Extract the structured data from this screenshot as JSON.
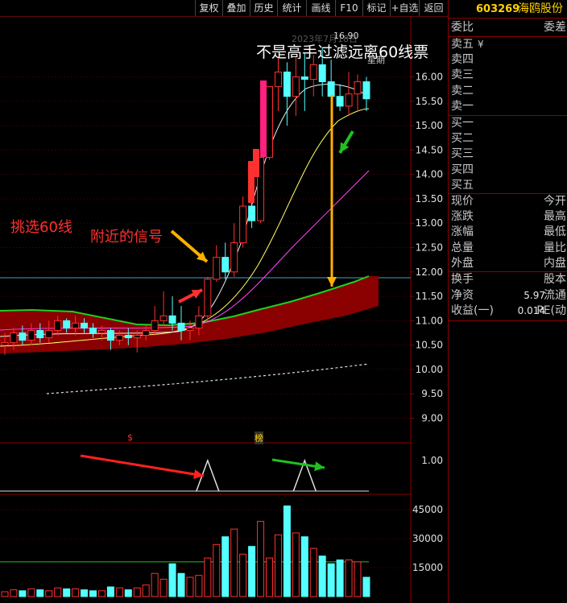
{
  "toolbar": {
    "buttons": [
      "复权",
      "叠加",
      "历史",
      "统计",
      "画线",
      "F10",
      "标记",
      "+自选",
      "返回"
    ]
  },
  "stock": {
    "code": "603269",
    "name": "海鸥股份",
    "code_color": "#ffd200"
  },
  "chart": {
    "date_overlay": "2023年7月18日",
    "date_partial": "星期",
    "high_marker": "16.90",
    "marks": [
      "$",
      "榜"
    ]
  },
  "annotations": {
    "title": "不是高手过滤远离60线票",
    "left_label": "挑选60线",
    "right_label": "附近的信号"
  },
  "quote": {
    "header_left": "委比",
    "header_right": "委差",
    "sell": [
      "卖五",
      "卖四",
      "卖三",
      "卖二",
      "卖一"
    ],
    "sell_suffix": "¥",
    "buy": [
      "买一",
      "买二",
      "买三",
      "买四",
      "买五"
    ],
    "stats_left": [
      "现价",
      "涨跌",
      "涨幅",
      "总量",
      "外盘"
    ],
    "stats_right": [
      "今开",
      "最高",
      "最低",
      "量比",
      "内盘"
    ],
    "fin": [
      {
        "label": "换手",
        "value": "",
        "right": "股本"
      },
      {
        "label": "净资",
        "value": "5.97",
        "right": "流通"
      },
      {
        "label": "收益(一)",
        "value": "0.014",
        "right": "PE(动"
      }
    ]
  },
  "chart_data": {
    "type": "candlestick",
    "price_axis": {
      "ticks": [
        "16.00",
        "15.50",
        "15.00",
        "14.50",
        "14.00",
        "13.50",
        "13.00",
        "12.50",
        "12.00",
        "11.50",
        "11.00",
        "10.50",
        "10.00",
        "9.50",
        "9.00"
      ],
      "range": [
        8.9,
        16.65
      ]
    },
    "reference_price": 11.88,
    "candles": [
      {
        "o": 10.5,
        "c": 10.55,
        "h": 10.75,
        "l": 10.3
      },
      {
        "o": 10.55,
        "c": 10.75,
        "h": 10.85,
        "l": 10.4
      },
      {
        "o": 10.75,
        "c": 10.6,
        "h": 10.9,
        "l": 10.5
      },
      {
        "o": 10.6,
        "c": 10.8,
        "h": 10.95,
        "l": 10.5
      },
      {
        "o": 10.8,
        "c": 10.65,
        "h": 10.95,
        "l": 10.55
      },
      {
        "o": 10.65,
        "c": 10.8,
        "h": 11.0,
        "l": 10.55
      },
      {
        "o": 10.8,
        "c": 11.0,
        "h": 11.1,
        "l": 10.7
      },
      {
        "o": 11.0,
        "c": 10.85,
        "h": 11.05,
        "l": 10.75
      },
      {
        "o": 10.85,
        "c": 10.95,
        "h": 11.1,
        "l": 10.7
      },
      {
        "o": 10.95,
        "c": 10.85,
        "h": 11.05,
        "l": 10.75
      },
      {
        "o": 10.85,
        "c": 10.75,
        "h": 10.95,
        "l": 10.65
      },
      {
        "o": 10.75,
        "c": 10.8,
        "h": 10.9,
        "l": 10.6
      },
      {
        "o": 10.8,
        "c": 10.6,
        "h": 10.85,
        "l": 10.4
      },
      {
        "o": 10.6,
        "c": 10.7,
        "h": 10.8,
        "l": 10.5
      },
      {
        "o": 10.7,
        "c": 10.65,
        "h": 10.85,
        "l": 10.5
      },
      {
        "o": 10.65,
        "c": 10.7,
        "h": 10.8,
        "l": 10.35
      },
      {
        "o": 10.7,
        "c": 10.8,
        "h": 10.9,
        "l": 10.6
      },
      {
        "o": 10.8,
        "c": 11.0,
        "h": 11.3,
        "l": 10.7
      },
      {
        "o": 11.0,
        "c": 11.1,
        "h": 11.6,
        "l": 10.9
      },
      {
        "o": 11.1,
        "c": 10.95,
        "h": 11.5,
        "l": 10.8
      },
      {
        "o": 10.95,
        "c": 10.8,
        "h": 11.3,
        "l": 10.6
      },
      {
        "o": 10.8,
        "c": 10.85,
        "h": 11.0,
        "l": 10.6
      },
      {
        "o": 10.85,
        "c": 11.1,
        "h": 11.3,
        "l": 10.7
      },
      {
        "o": 11.1,
        "c": 11.85,
        "h": 11.9,
        "l": 11.0
      },
      {
        "o": 11.85,
        "c": 12.3,
        "h": 12.55,
        "l": 11.8
      },
      {
        "o": 12.3,
        "c": 12.0,
        "h": 12.6,
        "l": 11.85
      },
      {
        "o": 12.0,
        "c": 12.6,
        "h": 13.0,
        "l": 11.9
      },
      {
        "o": 12.6,
        "c": 13.35,
        "h": 13.55,
        "l": 12.5
      },
      {
        "o": 13.35,
        "c": 13.05,
        "h": 13.6,
        "l": 12.9
      },
      {
        "o": 13.05,
        "c": 14.35,
        "h": 14.4,
        "l": 13.0
      },
      {
        "o": 14.35,
        "c": 15.8,
        "h": 15.8,
        "l": 14.3
      },
      {
        "o": 15.8,
        "c": 16.1,
        "h": 16.4,
        "l": 15.3
      },
      {
        "o": 16.1,
        "c": 15.6,
        "h": 16.3,
        "l": 15.0
      },
      {
        "o": 15.6,
        "c": 16.0,
        "h": 16.4,
        "l": 15.2
      },
      {
        "o": 16.0,
        "c": 15.95,
        "h": 16.5,
        "l": 15.3
      },
      {
        "o": 15.95,
        "c": 16.25,
        "h": 16.45,
        "l": 15.6
      },
      {
        "o": 16.25,
        "c": 15.9,
        "h": 16.6,
        "l": 15.6
      },
      {
        "o": 15.9,
        "c": 15.6,
        "h": 16.35,
        "l": 15.3
      },
      {
        "o": 15.6,
        "c": 15.4,
        "h": 15.85,
        "l": 15.3
      },
      {
        "o": 15.4,
        "c": 15.65,
        "h": 16.1,
        "l": 15.2
      },
      {
        "o": 15.65,
        "c": 15.9,
        "h": 16.05,
        "l": 15.3
      },
      {
        "o": 15.9,
        "c": 15.55,
        "h": 16.0,
        "l": 15.3
      }
    ],
    "indicator_axis": {
      "ticks": [
        "1.00"
      ]
    },
    "signals": [
      23,
      34
    ],
    "volume_axis": {
      "ticks": [
        "45000",
        "30000",
        "15000"
      ],
      "range": [
        0,
        48000
      ]
    },
    "volume_ma": 18000,
    "volume": [
      2500,
      3500,
      3000,
      4000,
      3500,
      3000,
      4500,
      4000,
      4000,
      3500,
      3000,
      3000,
      5000,
      4500,
      3500,
      4500,
      6000,
      12000,
      9000,
      17000,
      12000,
      10000,
      11000,
      20000,
      27000,
      31000,
      35000,
      22000,
      26000,
      39000,
      20000,
      32000,
      47000,
      33000,
      31000,
      25000,
      21000,
      17000,
      19000,
      19000,
      18000,
      10000
    ]
  }
}
